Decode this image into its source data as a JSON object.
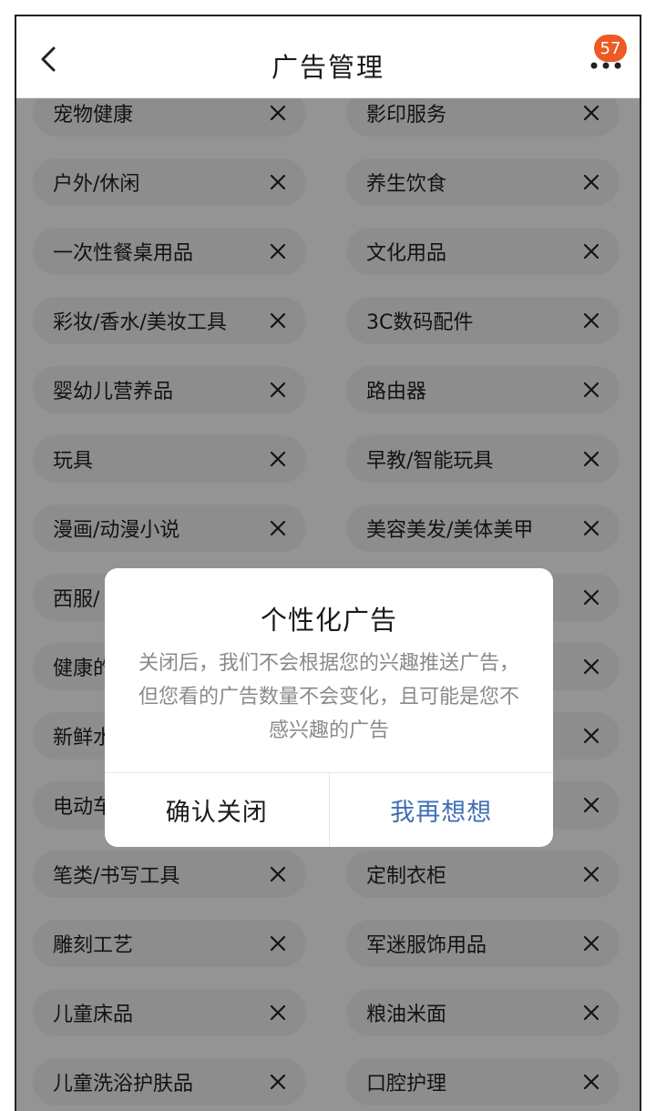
{
  "header": {
    "title": "广告管理",
    "badge_count": "57"
  },
  "tags": [
    {
      "left": "宠物健康",
      "right": "影印服务"
    },
    {
      "left": "户外/休闲",
      "right": "养生饮食"
    },
    {
      "left": "一次性餐桌用品",
      "right": "文化用品"
    },
    {
      "left": "彩妆/香水/美妆工具",
      "right": "3C数码配件"
    },
    {
      "left": "婴幼儿营养品",
      "right": "路由器"
    },
    {
      "left": "玩具",
      "right": "早教/智能玩具"
    },
    {
      "left": "漫画/动漫小说",
      "right": "美容美发/美体美甲"
    },
    {
      "left": "西服/",
      "right": ""
    },
    {
      "left": "健康的",
      "right": ""
    },
    {
      "left": "新鲜水",
      "right": ""
    },
    {
      "left": "电动车",
      "right": ""
    },
    {
      "left": "笔类/书写工具",
      "right": "定制衣柜"
    },
    {
      "left": "雕刻工艺",
      "right": "军迷服饰用品"
    },
    {
      "left": "儿童床品",
      "right": "粮油米面"
    },
    {
      "left": "儿童洗浴护肤品",
      "right": "口腔护理"
    }
  ],
  "dialog": {
    "title": "个性化广告",
    "body": "关闭后，我们不会根据您的兴趣推送广告，但您看的广告数量不会变化，且可能是您不感兴趣的广告",
    "confirm_label": "确认关闭",
    "cancel_label": "我再想想"
  },
  "colors": {
    "badge": "#ee5a24",
    "accent_button": "#3f6fb5",
    "overlay": "rgba(0,0,0,0.42)"
  }
}
